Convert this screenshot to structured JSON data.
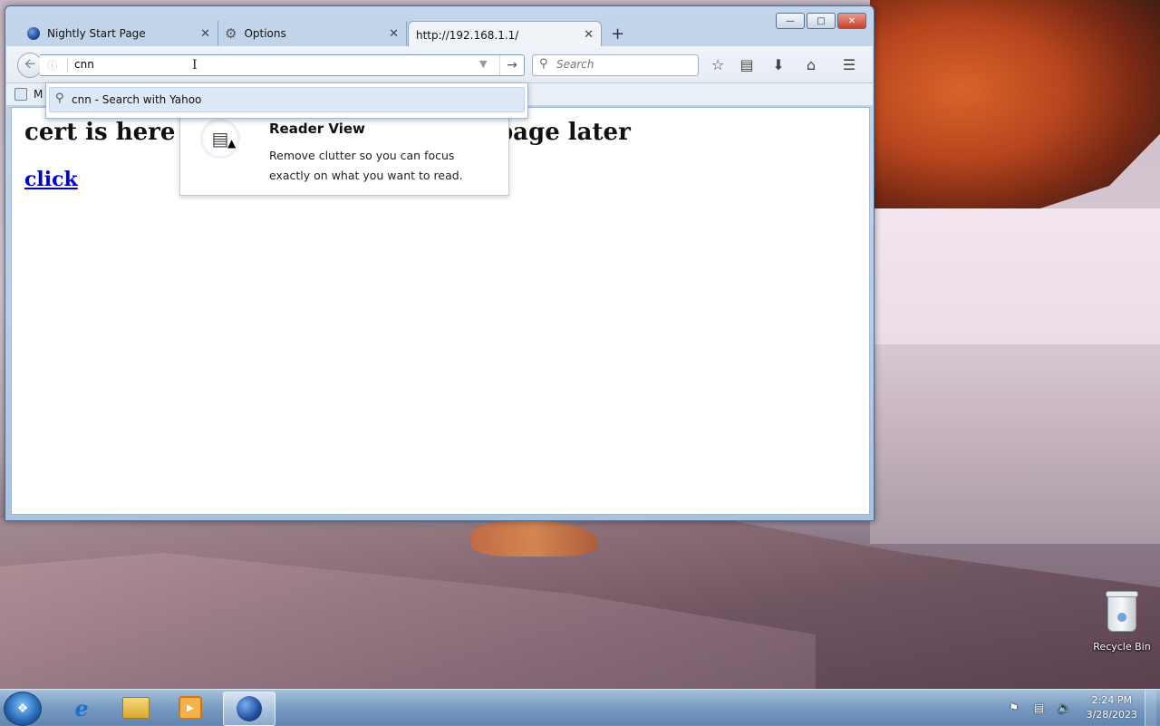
{
  "browser": {
    "tabs": [
      {
        "title": "Nightly Start Page",
        "icon": "globe-icon",
        "active": false
      },
      {
        "title": "Options",
        "icon": "gear-icon",
        "active": false
      },
      {
        "title": "http://192.168.1.1/",
        "icon": "",
        "active": true
      }
    ],
    "new_tab_glyph": "+",
    "url_value": "cnn",
    "search_placeholder": "Search",
    "bookmark_label": "M",
    "autocomplete": {
      "suggestion": "cnn - Search with Yahoo"
    }
  },
  "page": {
    "heading_start": "cert is here i",
    "heading_end": "page later",
    "link_text": "click"
  },
  "reader_view": {
    "title": "Reader View",
    "description": "Remove clutter so you can focus exactly on what you want to read."
  },
  "desktop": {
    "recycle_bin_label": "Recycle Bin"
  },
  "taskbar": {
    "time": "2:24 PM",
    "date": "3/28/2023",
    "pinned": [
      "internet-explorer",
      "file-explorer",
      "media-player",
      "firefox-nightly"
    ]
  },
  "colors": {
    "link": "#0000cc",
    "close_button": "#c5412b",
    "window_frame": "#b8cde6"
  }
}
